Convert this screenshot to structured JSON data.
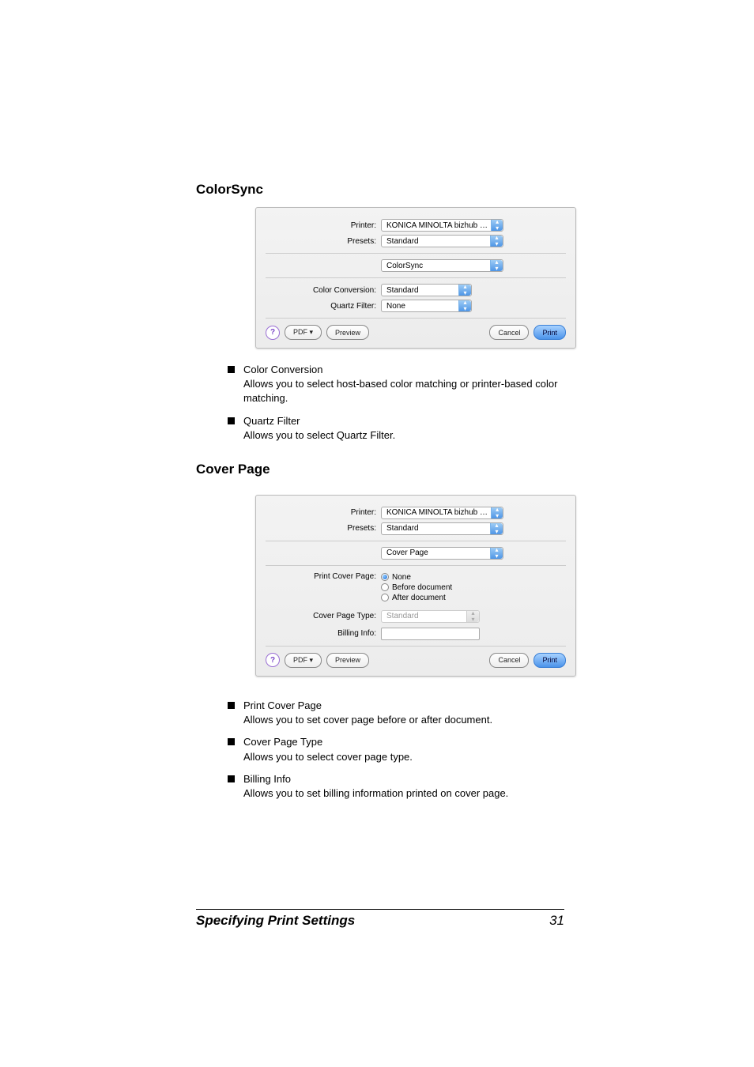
{
  "section1": {
    "heading": "ColorSync",
    "dialog": {
      "printer_label": "Printer:",
      "printer_value": "KONICA MINOLTA bizhub C10...",
      "presets_label": "Presets:",
      "presets_value": "Standard",
      "pane_value": "ColorSync",
      "color_conv_label": "Color Conversion:",
      "color_conv_value": "Standard",
      "quartz_label": "Quartz Filter:",
      "quartz_value": "None",
      "help": "?",
      "pdf": "PDF ▾",
      "preview": "Preview",
      "cancel": "Cancel",
      "print": "Print"
    },
    "items": [
      {
        "title": "Color Conversion",
        "body": "Allows you to select host-based color matching or printer-based color matching."
      },
      {
        "title": "Quartz Filter",
        "body": "Allows you to select Quartz Filter."
      }
    ]
  },
  "section2": {
    "heading": "Cover Page",
    "dialog": {
      "printer_label": "Printer:",
      "printer_value": "KONICA MINOLTA bizhub C10...",
      "presets_label": "Presets:",
      "presets_value": "Standard",
      "pane_value": "Cover Page",
      "print_cover_label": "Print Cover Page:",
      "radio_none": "None",
      "radio_before": "Before document",
      "radio_after": "After document",
      "cover_type_label": "Cover Page Type:",
      "cover_type_value": "Standard",
      "billing_label": "Billing Info:",
      "help": "?",
      "pdf": "PDF ▾",
      "preview": "Preview",
      "cancel": "Cancel",
      "print": "Print"
    },
    "items": [
      {
        "title": "Print Cover Page",
        "body": "Allows you to set cover page before or after document."
      },
      {
        "title": "Cover Page Type",
        "body": "Allows you to select cover page type."
      },
      {
        "title": "Billing Info",
        "body": "Allows you to set billing information printed on cover page."
      }
    ]
  },
  "footer": {
    "title": "Specifying Print Settings",
    "page": "31"
  }
}
